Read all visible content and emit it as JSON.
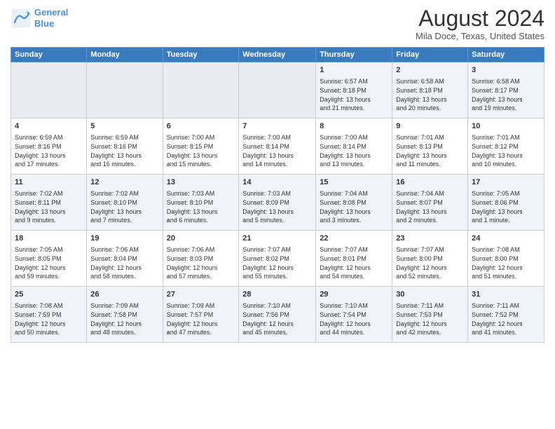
{
  "logo": {
    "line1": "General",
    "line2": "Blue"
  },
  "title": "August 2024",
  "subtitle": "Mila Doce, Texas, United States",
  "weekdays": [
    "Sunday",
    "Monday",
    "Tuesday",
    "Wednesday",
    "Thursday",
    "Friday",
    "Saturday"
  ],
  "weeks": [
    [
      {
        "day": "",
        "text": ""
      },
      {
        "day": "",
        "text": ""
      },
      {
        "day": "",
        "text": ""
      },
      {
        "day": "",
        "text": ""
      },
      {
        "day": "1",
        "text": "Sunrise: 6:57 AM\nSunset: 8:18 PM\nDaylight: 13 hours\nand 21 minutes."
      },
      {
        "day": "2",
        "text": "Sunrise: 6:58 AM\nSunset: 8:18 PM\nDaylight: 13 hours\nand 20 minutes."
      },
      {
        "day": "3",
        "text": "Sunrise: 6:58 AM\nSunset: 8:17 PM\nDaylight: 13 hours\nand 19 minutes."
      }
    ],
    [
      {
        "day": "4",
        "text": "Sunrise: 6:59 AM\nSunset: 8:16 PM\nDaylight: 13 hours\nand 17 minutes."
      },
      {
        "day": "5",
        "text": "Sunrise: 6:59 AM\nSunset: 8:16 PM\nDaylight: 13 hours\nand 16 minutes."
      },
      {
        "day": "6",
        "text": "Sunrise: 7:00 AM\nSunset: 8:15 PM\nDaylight: 13 hours\nand 15 minutes."
      },
      {
        "day": "7",
        "text": "Sunrise: 7:00 AM\nSunset: 8:14 PM\nDaylight: 13 hours\nand 14 minutes."
      },
      {
        "day": "8",
        "text": "Sunrise: 7:00 AM\nSunset: 8:14 PM\nDaylight: 13 hours\nand 13 minutes."
      },
      {
        "day": "9",
        "text": "Sunrise: 7:01 AM\nSunset: 8:13 PM\nDaylight: 13 hours\nand 11 minutes."
      },
      {
        "day": "10",
        "text": "Sunrise: 7:01 AM\nSunset: 8:12 PM\nDaylight: 13 hours\nand 10 minutes."
      }
    ],
    [
      {
        "day": "11",
        "text": "Sunrise: 7:02 AM\nSunset: 8:11 PM\nDaylight: 13 hours\nand 9 minutes."
      },
      {
        "day": "12",
        "text": "Sunrise: 7:02 AM\nSunset: 8:10 PM\nDaylight: 13 hours\nand 7 minutes."
      },
      {
        "day": "13",
        "text": "Sunrise: 7:03 AM\nSunset: 8:10 PM\nDaylight: 13 hours\nand 6 minutes."
      },
      {
        "day": "14",
        "text": "Sunrise: 7:03 AM\nSunset: 8:09 PM\nDaylight: 13 hours\nand 5 minutes."
      },
      {
        "day": "15",
        "text": "Sunrise: 7:04 AM\nSunset: 8:08 PM\nDaylight: 13 hours\nand 3 minutes."
      },
      {
        "day": "16",
        "text": "Sunrise: 7:04 AM\nSunset: 8:07 PM\nDaylight: 13 hours\nand 2 minutes."
      },
      {
        "day": "17",
        "text": "Sunrise: 7:05 AM\nSunset: 8:06 PM\nDaylight: 13 hours\nand 1 minute."
      }
    ],
    [
      {
        "day": "18",
        "text": "Sunrise: 7:05 AM\nSunset: 8:05 PM\nDaylight: 12 hours\nand 59 minutes."
      },
      {
        "day": "19",
        "text": "Sunrise: 7:06 AM\nSunset: 8:04 PM\nDaylight: 12 hours\nand 58 minutes."
      },
      {
        "day": "20",
        "text": "Sunrise: 7:06 AM\nSunset: 8:03 PM\nDaylight: 12 hours\nand 57 minutes."
      },
      {
        "day": "21",
        "text": "Sunrise: 7:07 AM\nSunset: 8:02 PM\nDaylight: 12 hours\nand 55 minutes."
      },
      {
        "day": "22",
        "text": "Sunrise: 7:07 AM\nSunset: 8:01 PM\nDaylight: 12 hours\nand 54 minutes."
      },
      {
        "day": "23",
        "text": "Sunrise: 7:07 AM\nSunset: 8:00 PM\nDaylight: 12 hours\nand 52 minutes."
      },
      {
        "day": "24",
        "text": "Sunrise: 7:08 AM\nSunset: 8:00 PM\nDaylight: 12 hours\nand 51 minutes."
      }
    ],
    [
      {
        "day": "25",
        "text": "Sunrise: 7:08 AM\nSunset: 7:59 PM\nDaylight: 12 hours\nand 50 minutes."
      },
      {
        "day": "26",
        "text": "Sunrise: 7:09 AM\nSunset: 7:58 PM\nDaylight: 12 hours\nand 48 minutes."
      },
      {
        "day": "27",
        "text": "Sunrise: 7:09 AM\nSunset: 7:57 PM\nDaylight: 12 hours\nand 47 minutes."
      },
      {
        "day": "28",
        "text": "Sunrise: 7:10 AM\nSunset: 7:56 PM\nDaylight: 12 hours\nand 45 minutes."
      },
      {
        "day": "29",
        "text": "Sunrise: 7:10 AM\nSunset: 7:54 PM\nDaylight: 12 hours\nand 44 minutes."
      },
      {
        "day": "30",
        "text": "Sunrise: 7:11 AM\nSunset: 7:53 PM\nDaylight: 12 hours\nand 42 minutes."
      },
      {
        "day": "31",
        "text": "Sunrise: 7:11 AM\nSunset: 7:52 PM\nDaylight: 12 hours\nand 41 minutes."
      }
    ]
  ]
}
